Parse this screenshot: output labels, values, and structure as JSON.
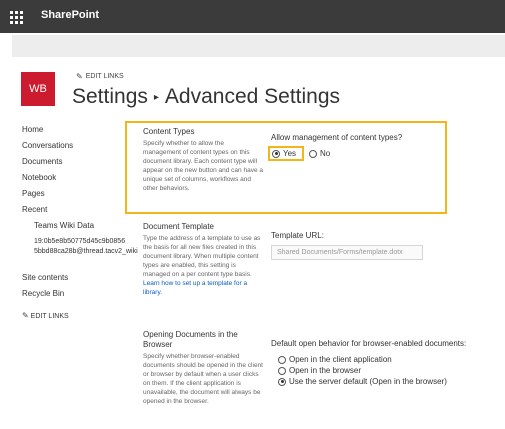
{
  "suite_bar": {
    "app_name": "SharePoint",
    "app_launcher_icon": "waffle-icon"
  },
  "site": {
    "logo_text": "WB",
    "edit_links_label": "EDIT LINKS"
  },
  "title": {
    "part1": "Settings",
    "separator": "▸",
    "part2": "Advanced Settings"
  },
  "nav": {
    "items": [
      "Home",
      "Conversations",
      "Documents",
      "Notebook",
      "Pages",
      "Recent"
    ],
    "recent_items": [
      "Teams Wiki Data",
      "19:0b5e8b50775d45c9b0856 5bbd88ca28b@thread.tacv2_wiki"
    ],
    "bottom_items": [
      "Site contents",
      "Recycle Bin"
    ],
    "edit_links_label": "EDIT LINKS"
  },
  "content_types": {
    "heading": "Content Types",
    "description": "Specify whether to allow the management of content types on this document library. Each content type will appear on the new button and can have a unique set of columns, workflows and other behaviors.",
    "question": "Allow management of content types?",
    "option_yes": "Yes",
    "option_no": "No",
    "selected": "Yes"
  },
  "document_template": {
    "heading": "Document Template",
    "description": "Type the address of a template to use as the basis for all new files created in this document library. When multiple content types are enabled, this setting is managed on a per content type basis.",
    "link_text": "Learn how to set up a template for a library.",
    "url_label": "Template URL:",
    "url_value": "Shared Documents/Forms/template.dotx"
  },
  "opening_documents": {
    "heading": "Opening Documents in the Browser",
    "description": "Specify whether browser-enabled documents should be opened in the client or browser by default when a user clicks on them. If the client application is unavailable, the document will always be opened in the browser.",
    "question": "Default open behavior for browser-enabled documents:",
    "options": [
      "Open in the client application",
      "Open in the browser",
      "Use the server default (Open in the browser)"
    ],
    "selected_index": 2
  },
  "colors": {
    "suite_bar": "#3b3b3b",
    "logo": "#cc1b2f",
    "highlight": "#f2b61b",
    "link": "#0a5cbf"
  }
}
